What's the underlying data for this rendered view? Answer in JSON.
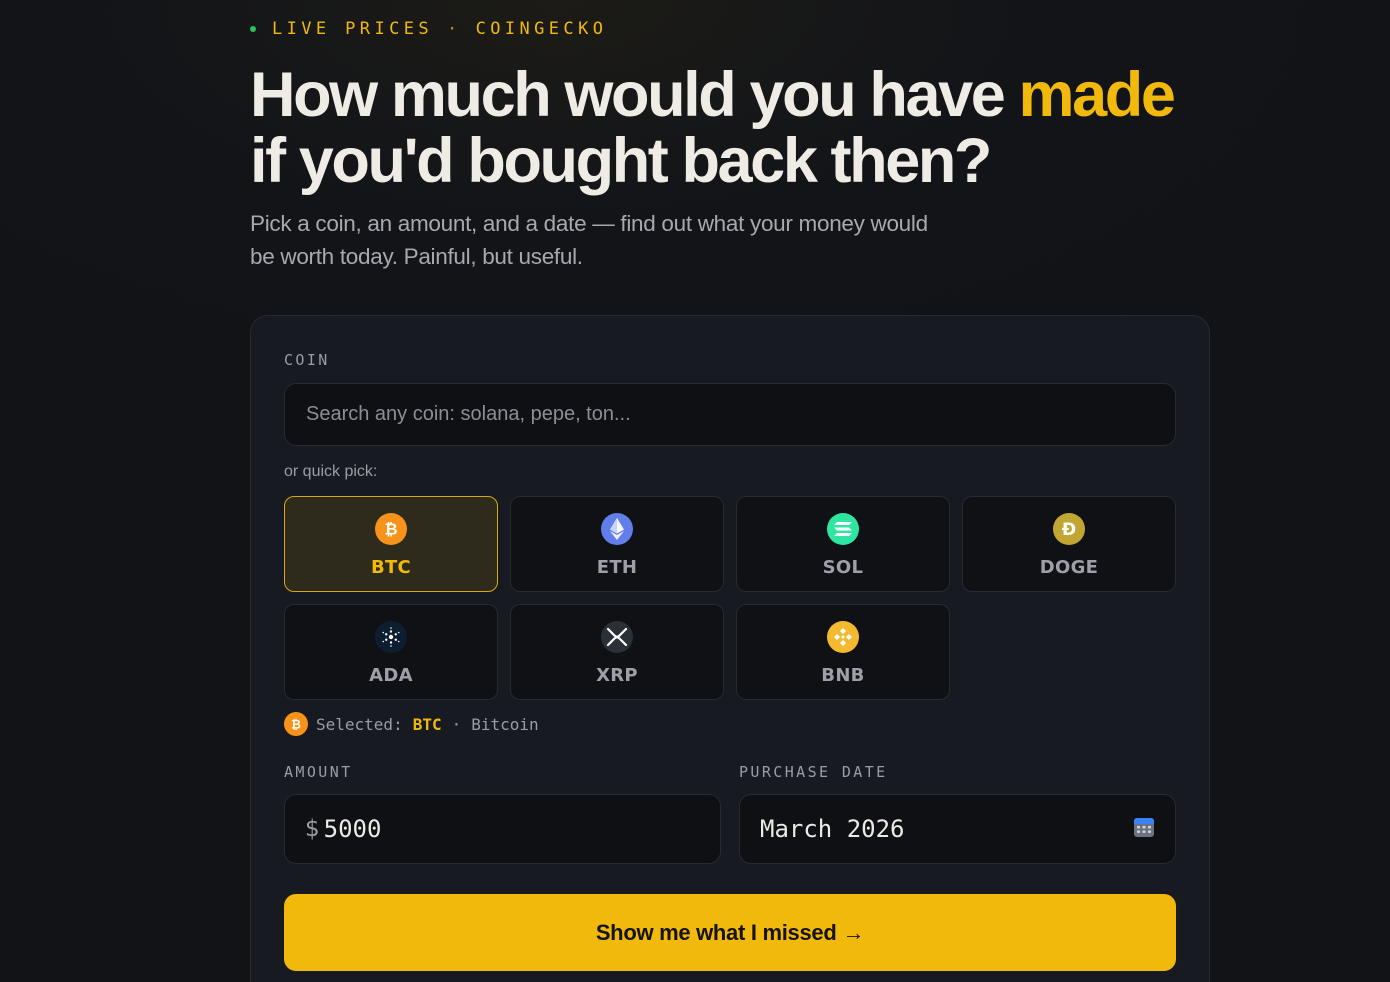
{
  "header": {
    "eyebrow_left": "LIVE PRICES",
    "eyebrow_sep": "·",
    "eyebrow_right": "COINGECKO",
    "headline_part1": "How much would you have ",
    "headline_accent": "made",
    "headline_part2": "if you'd bought back then?",
    "subtitle": "Pick a coin, an amount, and a date — find out what your money would be worth today. Painful, but useful."
  },
  "form": {
    "coin_label": "COIN",
    "search_placeholder": "Search any coin: solana, pepe, ton...",
    "search_value": "",
    "quick_pick_label": "or quick pick:",
    "coins": [
      {
        "symbol": "BTC",
        "active": true,
        "icon": "bitcoin-icon",
        "color": "#f7931a"
      },
      {
        "symbol": "ETH",
        "active": false,
        "icon": "ethereum-icon",
        "color": "#627eea"
      },
      {
        "symbol": "SOL",
        "active": false,
        "icon": "solana-icon",
        "color": "#14f195"
      },
      {
        "symbol": "DOGE",
        "active": false,
        "icon": "dogecoin-icon",
        "color": "#c2a633"
      },
      {
        "symbol": "ADA",
        "active": false,
        "icon": "cardano-icon",
        "color": "#0d1e30"
      },
      {
        "symbol": "XRP",
        "active": false,
        "icon": "xrp-icon",
        "color": "#23292f"
      },
      {
        "symbol": "BNB",
        "active": false,
        "icon": "bnb-icon",
        "color": "#f3ba2f"
      }
    ],
    "selected_prefix": "Selected:",
    "selected_symbol": "BTC",
    "selected_sep": "·",
    "selected_name": "Bitcoin",
    "amount_label": "AMOUNT",
    "amount_currency": "$",
    "amount_value": "5000",
    "date_label": "PURCHASE DATE",
    "date_value": "March 2026",
    "submit_label": "Show me what I missed",
    "submit_arrow": "→"
  },
  "colors": {
    "accent": "#f0b90b",
    "background": "#121418",
    "card": "#171a20",
    "live_dot": "#22c55e"
  }
}
